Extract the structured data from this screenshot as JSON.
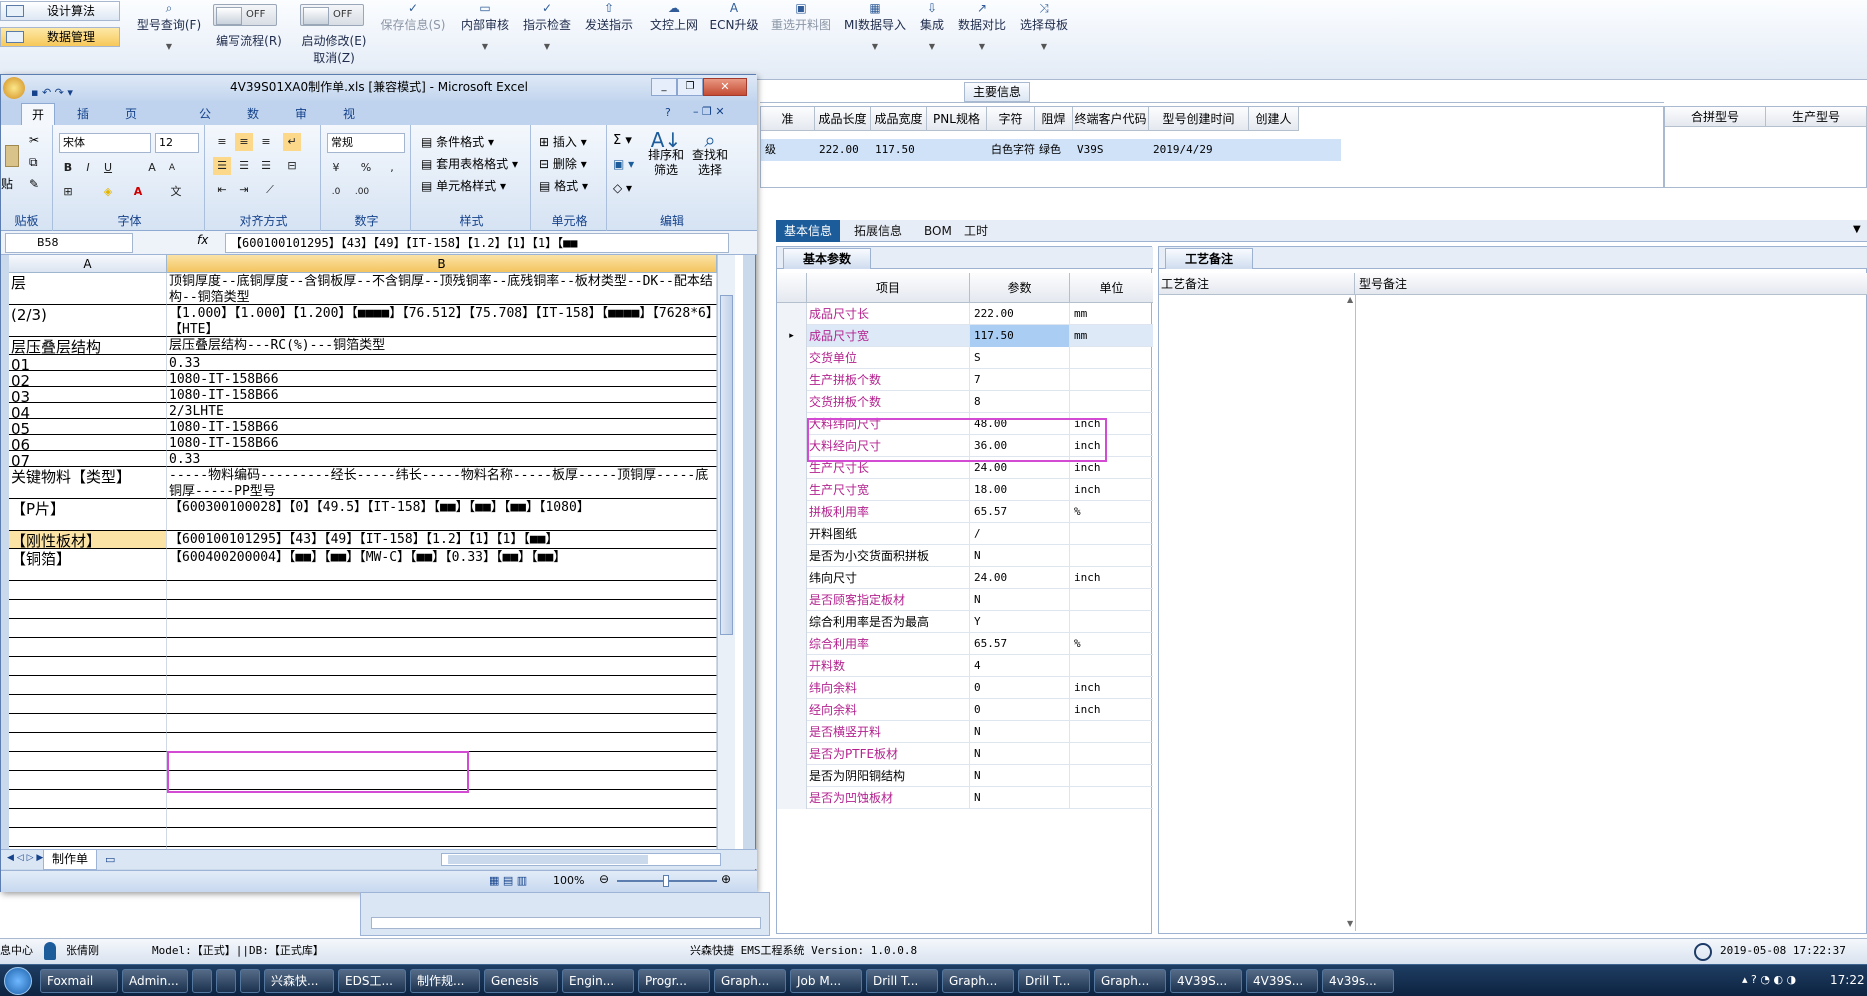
{
  "nav": {
    "design": "设计算法",
    "data_mgmt": "数据管理"
  },
  "ribbon": {
    "type_query": "型号查询(F)",
    "edit_flow": "编写流程(R)",
    "edit_flow_toggle": "OFF",
    "start_modify": "启动修改(E)",
    "start_modify_toggle": "OFF",
    "cancel": "取消(Z)",
    "save_info": "保存信息(S)",
    "internal_review": "内部审核",
    "indicator_check": "指示检查",
    "send_indicator": "发送指示",
    "upload_doc": "文控上网",
    "ecn_upgrade": "ECN升级",
    "regen_chart": "重选开料图",
    "mi_import": "MI数据导入",
    "integrate": "集成",
    "data_compare": "数据对比",
    "select_motherboard": "选择母板"
  },
  "main_info": {
    "caption": "主要信息",
    "headers": [
      "准",
      "成品长度",
      "成品宽度",
      "PNL规格",
      "字符",
      "阻焊",
      "终端客户代码",
      "型号创建时间",
      "创建人"
    ],
    "row": [
      "级",
      "222.00",
      "117.50",
      "",
      "白色字符",
      "绿色",
      "V39S",
      "2019/4/29",
      ""
    ],
    "right_headers": [
      "合拼型号",
      "生产型号"
    ]
  },
  "tabs": [
    "基本信息",
    "拓展信息",
    "BOM",
    "工时"
  ],
  "basic_params": {
    "title": "基本参数",
    "headers": [
      "项目",
      "参数",
      "单位"
    ],
    "rows": [
      {
        "k": "成品尺寸长",
        "v": "222.00",
        "u": "mm"
      },
      {
        "k": "成品尺寸宽",
        "v": "117.50",
        "u": "mm"
      },
      {
        "k": "交货单位",
        "v": "S",
        "u": ""
      },
      {
        "k": "生产拼板个数",
        "v": "7",
        "u": ""
      },
      {
        "k": "交货拼板个数",
        "v": "8",
        "u": ""
      },
      {
        "k": "大料纬向尺寸",
        "v": "48.00",
        "u": "inch"
      },
      {
        "k": "大料经向尺寸",
        "v": "36.00",
        "u": "inch"
      },
      {
        "k": "生产尺寸长",
        "v": "24.00",
        "u": "inch"
      },
      {
        "k": "生产尺寸宽",
        "v": "18.00",
        "u": "inch"
      },
      {
        "k": "拼板利用率",
        "v": "65.57",
        "u": "%"
      },
      {
        "k": "开料图纸",
        "v": "/",
        "u": ""
      },
      {
        "k": "是否为小交货面积拼板",
        "v": "N",
        "u": ""
      },
      {
        "k": "纬向尺寸",
        "v": "24.00",
        "u": "inch"
      },
      {
        "k": "是否顾客指定板材",
        "v": "N",
        "u": ""
      },
      {
        "k": "综合利用率是否为最高",
        "v": "Y",
        "u": ""
      },
      {
        "k": "综合利用率",
        "v": "65.57",
        "u": "%"
      },
      {
        "k": "开料数",
        "v": "4",
        "u": ""
      },
      {
        "k": "纬向余料",
        "v": "0",
        "u": "inch"
      },
      {
        "k": "经向余料",
        "v": "0",
        "u": "inch"
      },
      {
        "k": "是否横竖开料",
        "v": "N",
        "u": ""
      },
      {
        "k": "是否为PTFE板材",
        "v": "N",
        "u": ""
      },
      {
        "k": "是否为阴阳铜结构",
        "v": "N",
        "u": ""
      },
      {
        "k": "是否为凹蚀板材",
        "v": "N",
        "u": ""
      }
    ]
  },
  "process_notes": {
    "title": "工艺备注",
    "col1": "工艺备注",
    "col2": "型号备注"
  },
  "excel": {
    "title": "4V39S01XA0制作单.xls  [兼容模式] - Microsoft Excel",
    "tabs": [
      "开始",
      "插入",
      "页面布局",
      "公式",
      "数据",
      "审阅",
      "视图"
    ],
    "font_name": "宋体",
    "font_size": "12",
    "number_format": "常规",
    "groups": {
      "clipboard": "贴板",
      "font": "字体",
      "align": "对齐方式",
      "number": "数字",
      "style": "样式",
      "cells": "单元格",
      "edit": "编辑"
    },
    "paste": "贴",
    "style_items": [
      "条件格式",
      "套用表格格式",
      "单元格样式"
    ],
    "cell_items": [
      "插入",
      "删除",
      "格式"
    ],
    "edit_items": [
      "排序和\n筛选",
      "查找和\n选择"
    ],
    "name_box": "B58",
    "formula": "【600100101295】【43】【49】【IT-158】【1.2】【1】【1】【■■",
    "col_a": "A",
    "col_b": "B",
    "rows": [
      {
        "a": "层",
        "b": "顶铜厚度--底铜厚度--含铜板厚--不含铜厚--顶残铜率--底残铜率--板材类型--DK--配本结构--铜箔类型",
        "h": 32
      },
      {
        "a": "(2/3)",
        "b": "【1.000】【1.000】【1.200】【■■■■】【76.512】【75.708】【IT-158】【■■■■】【7628*6】【HTE】",
        "h": 32
      },
      {
        "a": "层压叠层结构",
        "b": "层压叠层结构---RC(%)---铜箔类型",
        "h": 18
      },
      {
        "a": "01",
        "b": "0.33",
        "h": 16
      },
      {
        "a": "02",
        "b": "1080-IT-158B66",
        "h": 16
      },
      {
        "a": "03",
        "b": "1080-IT-158B66",
        "h": 16
      },
      {
        "a": "04",
        "b": "2/3LHTE",
        "h": 16
      },
      {
        "a": "05",
        "b": "1080-IT-158B66",
        "h": 16
      },
      {
        "a": "06",
        "b": "1080-IT-158B66",
        "h": 16
      },
      {
        "a": "07",
        "b": "0.33",
        "h": 16
      },
      {
        "a": "关键物料【类型】",
        "b": "-----物料编码---------经长-----纬长-----物料名称-----板厚-----顶铜厚-----底铜厚-----PP型号",
        "h": 32
      },
      {
        "a": "【P片】",
        "b": "【600300100028】【0】【49.5】【IT-158】【■■】【■■】【■■】【1080】",
        "h": 32
      },
      {
        "a": "【刚性板材】",
        "b": "【600100101295】【43】【49】【IT-158】【1.2】【1】【1】【■■】",
        "h": 18
      },
      {
        "a": "【铜箔】",
        "b": "【600400200004】【■■】【■■】【MW-C】【■■】【0.33】【■■】【■■】",
        "h": 32
      }
    ],
    "sheet_tab": "制作单",
    "zoom": "100%"
  },
  "status": {
    "msg": "息中心",
    "user": "张倩刚",
    "model_db": "Model:【正式】||DB:【正式库】",
    "system": "兴森快捷 EMS工程系统 Version: 1.0.0.8",
    "datetime": "2019-05-08 17:22:37"
  },
  "taskbar": {
    "items": [
      "Foxmail",
      "Admin...",
      "",
      "",
      "",
      "兴森快...",
      "EDS工...",
      "制作规...",
      "Genesis",
      "Engin...",
      "Progr...",
      "Graph...",
      "Job M...",
      "Drill T...",
      "Graph...",
      "Drill T...",
      "Graph...",
      "4V39S...",
      "4V39S...",
      "4v39s..."
    ],
    "time": "17:22"
  },
  "accent": "#1d5c9b",
  "highlight_color": "#d34bd3"
}
